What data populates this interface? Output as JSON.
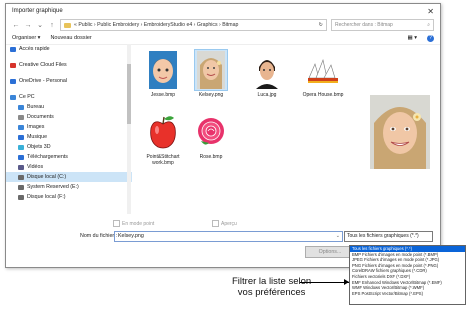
{
  "window": {
    "title": "Importer graphique",
    "close_glyph": "✕"
  },
  "nav": {
    "back": "←",
    "forward": "→",
    "up_dropdown": "⌄",
    "up": "↑",
    "breadcrumb": "«  Public  ›  Public Embroidery  ›  EmbroideryStudio e4  ›  Graphics  ›  Bitmap",
    "refresh": "↻",
    "search_placeholder": "Rechercher dans : Bitmap",
    "search_glyph": "⌕"
  },
  "toolbar": {
    "organize": "Organiser ▾",
    "new_folder": "Nouveau dossier",
    "view": "▦ ▾",
    "help": "?"
  },
  "sidebar": {
    "items": [
      {
        "label": "Accès rapide",
        "icon": "star-icon",
        "color": "#2b6fd6",
        "indent": false
      },
      {
        "label": "Creative Cloud Files",
        "icon": "cloud-icon",
        "color": "#d6342b",
        "indent": false
      },
      {
        "label": "OneDrive - Personal",
        "icon": "onedrive-icon",
        "color": "#2b6fd6",
        "indent": false
      },
      {
        "label": "Ce PC",
        "icon": "computer-icon",
        "color": "#3a85d8",
        "indent": false
      },
      {
        "label": "Bureau",
        "icon": "desktop-icon",
        "color": "#3a85d8",
        "indent": true
      },
      {
        "label": "Documents",
        "icon": "documents-icon",
        "color": "#8a8a8a",
        "indent": true
      },
      {
        "label": "Images",
        "icon": "images-icon",
        "color": "#3a85d8",
        "indent": true
      },
      {
        "label": "Musique",
        "icon": "music-icon",
        "color": "#2b6fd6",
        "indent": true
      },
      {
        "label": "Objets 3D",
        "icon": "cube-icon",
        "color": "#3ab0d8",
        "indent": true
      },
      {
        "label": "Téléchargements",
        "icon": "download-icon",
        "color": "#2b6fd6",
        "indent": true
      },
      {
        "label": "Vidéos",
        "icon": "video-icon",
        "color": "#5a5a8a",
        "indent": true
      },
      {
        "label": "Disque local (C:)",
        "icon": "drive-icon",
        "color": "#6a6a6a",
        "indent": true,
        "selected": true
      },
      {
        "label": "System Reserved (E:)",
        "icon": "drive-icon",
        "color": "#6a6a6a",
        "indent": true
      },
      {
        "label": "Disque local (F:)",
        "icon": "drive-icon",
        "color": "#6a6a6a",
        "indent": true
      }
    ]
  },
  "files": [
    {
      "name": "Jesse.bmp"
    },
    {
      "name": "Kelsey.png",
      "selected": true
    },
    {
      "name": "Luca.jpg"
    },
    {
      "name": "Opera House.bmp"
    },
    {
      "name": "Point&Stitchart work.bmp"
    },
    {
      "name": "Rose.bmp"
    }
  ],
  "footer": {
    "mode_point": "En mode point",
    "apercu": "Aperçu",
    "filename_label": "Nom du fichier :",
    "filename_value": "Kelsey.png",
    "filetype_value": "Tous les fichiers graphiques (*.*)",
    "open_button": "Options...",
    "dropdown_arrow": "⌄"
  },
  "filetype_options": [
    "Tous les fichiers graphiques (*.*)",
    "BMP Fichiers d'images en mode point (*.BMP)",
    "JPEG Fichiers d'images en mode point (*.JPG)",
    "PNG Fichiers d'images en mode point (*.PNG)",
    "CorelDRAW fichiers graphiques (*.CDR)",
    "Fichiers vectoriels DXF (*.DXF)",
    "EMF Enhanced Windows Vector/Bitmap (*.EMF)",
    "WMF Windows Vector/Bitmap (*.WMF)",
    "EPS PostScript Vector/Bitmap (*.EPS)"
  ],
  "callout": {
    "line1": "Filtrer la liste selon",
    "line2": "vos préférences"
  },
  "colors": {
    "selection": "#cce4f7",
    "accent": "#0a64d8"
  }
}
